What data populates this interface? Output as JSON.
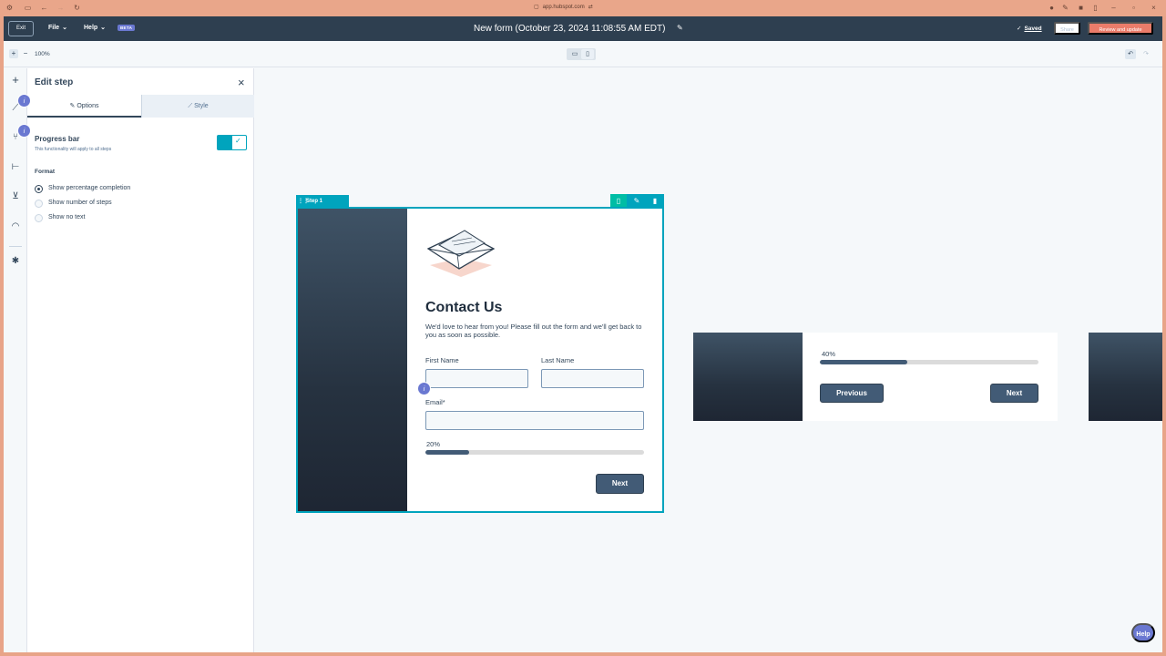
{
  "browser": {
    "url": "app.hubspot.com"
  },
  "topbar": {
    "exit_label": "Exit",
    "file_label": "File",
    "help_label": "Help",
    "beta_label": "BETA",
    "form_title": "New form (October 23, 2024 11:08:55 AM EDT)",
    "saved_label": "Saved",
    "share_label": "Share",
    "review_label": "Review and update"
  },
  "toolbar": {
    "zoom_level": "100%"
  },
  "panel": {
    "title": "Edit step",
    "tabs": [
      {
        "label": "Options",
        "icon": "pencil-icon"
      },
      {
        "label": "Style",
        "icon": "brush-icon"
      }
    ],
    "progress_bar_label": "Progress bar",
    "progress_bar_sub": "This functionality will apply to all steps",
    "progress_bar_enabled": true,
    "format_label": "Format",
    "format_options": [
      {
        "label": "Show percentage completion",
        "selected": true
      },
      {
        "label": "Show number of steps",
        "selected": false
      },
      {
        "label": "Show no text",
        "selected": false
      }
    ]
  },
  "step1": {
    "tab_label": "Step 1",
    "title": "Contact Us",
    "description": "We'd love to hear from you! Please fill out the form and we'll get back to you as soon as possible.",
    "first_name_label": "First Name",
    "last_name_label": "Last Name",
    "email_label": "Email*",
    "progress_text": "20%",
    "progress_value": 0.2,
    "next_label": "Next"
  },
  "step2": {
    "progress_text": "40%",
    "progress_value": 0.4,
    "previous_label": "Previous",
    "next_label": "Next"
  },
  "help_label": "Help",
  "badge_label": "i",
  "colors": {
    "topbar": "#2e3f50",
    "accent_teal": "#00a4bd",
    "button_dark": "#425b76",
    "review_orange": "#ea7c6a",
    "beta_purple": "#6a78d1"
  }
}
